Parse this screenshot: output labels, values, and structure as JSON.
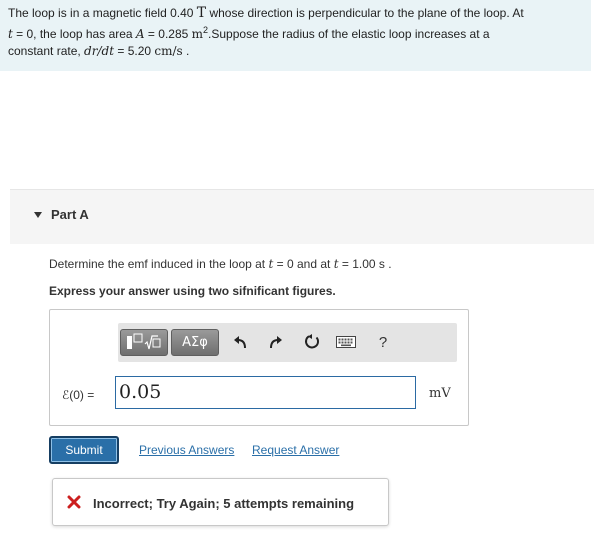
{
  "problem": {
    "t1": "The loop is in a magnetic field 0.40 ",
    "t1_unit": "T",
    "t2": " whose direction is perpendicular to the plane of the loop. At",
    "t3_var": "t",
    "t3": " = 0, the loop has area ",
    "t3_A": "A",
    "t3b": " = 0.285 ",
    "t3_unit": "m",
    "t3_sup": "2",
    "t4": ".Suppose the radius of the elastic loop increases at a",
    "t5": "constant rate, ",
    "t5_var": "dr/dt",
    "t5b": " = 5.20 ",
    "t5_unit": "cm/s",
    "t5c": " ."
  },
  "part": {
    "label": "Part A"
  },
  "question": {
    "q1": "Determine the emf induced in the loop at ",
    "q_t": "t",
    "q2": " = 0 and at ",
    "q3": " = 1.00 s .",
    "instruction": "Express your answer using two sifnificant figures."
  },
  "answer": {
    "label_sym": "ℰ(0)",
    "label_eq": " = ",
    "value": "0.05",
    "unit": "mV"
  },
  "toolbar": {
    "greek_label": "ΑΣφ",
    "help_label": "?"
  },
  "actions": {
    "submit_label": "Submit",
    "previous_answers": "Previous Answers",
    "request_answer": "Request Answer"
  },
  "feedback": {
    "text": "Incorrect; Try Again; 5 attempts remaining"
  },
  "colors": {
    "problem_bg": "#e9f3f6",
    "accent": "#2a6fa8",
    "error": "#cc1f1f"
  }
}
